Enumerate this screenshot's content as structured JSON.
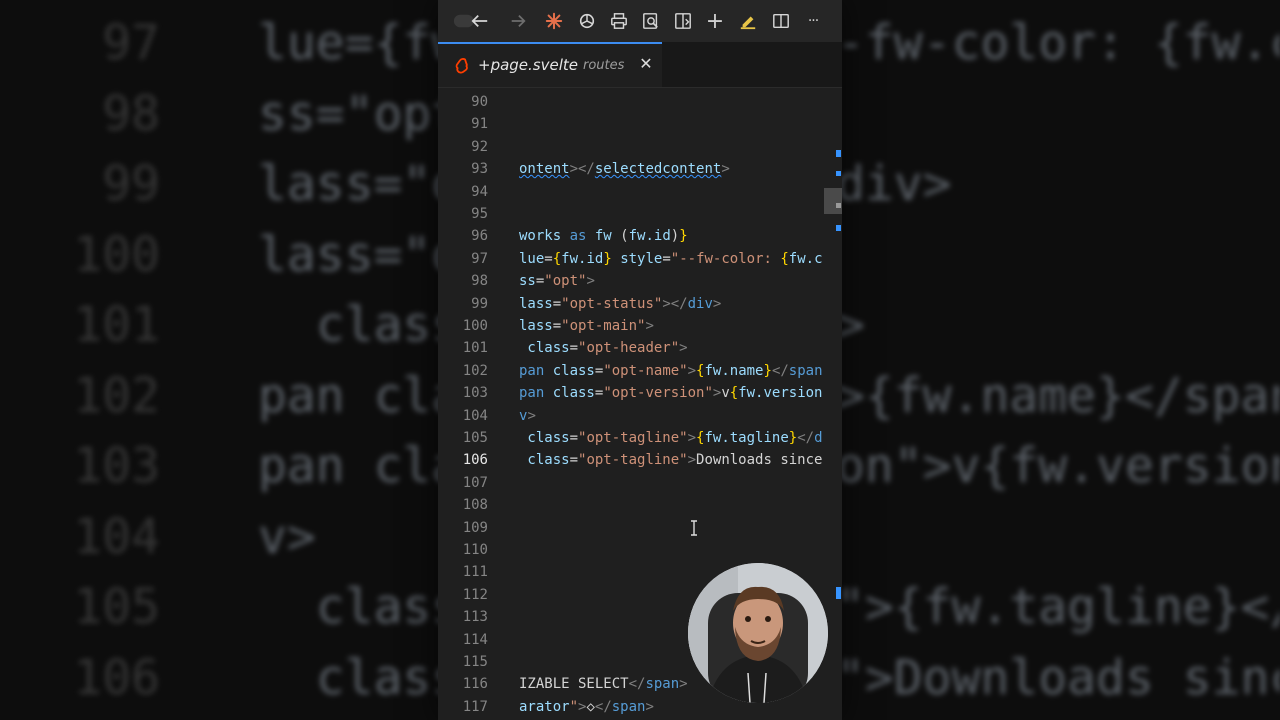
{
  "background": {
    "lines": [
      {
        "num": "97",
        "code": "lue={fw.id} style=\"--fw-color: {fw.c"
      },
      {
        "num": "98",
        "code": "ss=\"opt\">"
      },
      {
        "num": "99",
        "code": "lass=\"opt-status\"></div>"
      },
      {
        "num": "100",
        "code": "lass=\"opt-main\">"
      },
      {
        "num": "101",
        "code": "  class=\"opt-header\">"
      },
      {
        "num": "102",
        "code": "pan class=\"opt-name\">{fw.name}</span"
      },
      {
        "num": "103",
        "code": "pan class=\"opt-version\">v{fw.version"
      },
      {
        "num": "104",
        "code": "v>"
      },
      {
        "num": "105",
        "code": "  class=\"opt-tagline\">{fw.tagline}</d"
      },
      {
        "num": "106",
        "code": "  class=\"opt-tagline\">Downloads since"
      }
    ]
  },
  "toolbar": {
    "icons": [
      "back-arrow-icon",
      "forward-arrow-icon",
      "claude-icon",
      "openai-icon",
      "print-icon",
      "search-doc-icon",
      "split-compare-icon",
      "add-icon",
      "highlight-pen-icon",
      "split-editor-icon",
      "more-icon"
    ],
    "more_label": "···",
    "add_label": "+"
  },
  "tab": {
    "title": "+page.svelte",
    "description": "routes",
    "close_label": "✕",
    "icon": "svelte-icon"
  },
  "editor": {
    "active_line": "106",
    "lines": [
      {
        "num": "90",
        "tokens": []
      },
      {
        "num": "91",
        "tokens": []
      },
      {
        "num": "92",
        "tokens": []
      },
      {
        "num": "93",
        "tokens": [
          {
            "t": "ontent",
            "c": "t-attr squiggle"
          },
          {
            "t": "></",
            "c": "t-tag"
          },
          {
            "t": "selectedcontent",
            "c": "t-attr squiggle"
          },
          {
            "t": ">",
            "c": "t-tag"
          }
        ]
      },
      {
        "num": "94",
        "tokens": []
      },
      {
        "num": "95",
        "tokens": []
      },
      {
        "num": "96",
        "tokens": [
          {
            "t": "works ",
            "c": "t-var"
          },
          {
            "t": "as ",
            "c": "t-kw"
          },
          {
            "t": "fw ",
            "c": "t-var"
          },
          {
            "t": "(",
            "c": "t-plain"
          },
          {
            "t": "fw.id",
            "c": "t-var"
          },
          {
            "t": ")",
            "c": "t-plain"
          },
          {
            "t": "}",
            "c": "t-brace"
          }
        ]
      },
      {
        "num": "97",
        "tokens": [
          {
            "t": "lue",
            "c": "t-attr"
          },
          {
            "t": "=",
            "c": "t-plain"
          },
          {
            "t": "{",
            "c": "t-brace"
          },
          {
            "t": "fw.id",
            "c": "t-var"
          },
          {
            "t": "} ",
            "c": "t-brace"
          },
          {
            "t": "style",
            "c": "t-attr"
          },
          {
            "t": "=",
            "c": "t-plain"
          },
          {
            "t": "\"--fw-color: ",
            "c": "t-str"
          },
          {
            "t": "{",
            "c": "t-brace"
          },
          {
            "t": "fw.c",
            "c": "t-var"
          }
        ]
      },
      {
        "num": "98",
        "tokens": [
          {
            "t": "ss",
            "c": "t-attr"
          },
          {
            "t": "=",
            "c": "t-plain"
          },
          {
            "t": "\"opt\"",
            "c": "t-str"
          },
          {
            "t": ">",
            "c": "t-tag"
          }
        ]
      },
      {
        "num": "99",
        "tokens": [
          {
            "t": "lass",
            "c": "t-attr"
          },
          {
            "t": "=",
            "c": "t-plain"
          },
          {
            "t": "\"opt-status\"",
            "c": "t-str"
          },
          {
            "t": "></",
            "c": "t-tag"
          },
          {
            "t": "div",
            "c": "t-name"
          },
          {
            "t": ">",
            "c": "t-tag"
          }
        ]
      },
      {
        "num": "100",
        "tokens": [
          {
            "t": "lass",
            "c": "t-attr"
          },
          {
            "t": "=",
            "c": "t-plain"
          },
          {
            "t": "\"opt-main\"",
            "c": "t-str"
          },
          {
            "t": ">",
            "c": "t-tag"
          }
        ]
      },
      {
        "num": "101",
        "tokens": [
          {
            "t": " class",
            "c": "t-attr"
          },
          {
            "t": "=",
            "c": "t-plain"
          },
          {
            "t": "\"opt-header\"",
            "c": "t-str"
          },
          {
            "t": ">",
            "c": "t-tag"
          }
        ]
      },
      {
        "num": "102",
        "tokens": [
          {
            "t": "pan ",
            "c": "t-name"
          },
          {
            "t": "class",
            "c": "t-attr"
          },
          {
            "t": "=",
            "c": "t-plain"
          },
          {
            "t": "\"opt-name\"",
            "c": "t-str"
          },
          {
            "t": ">",
            "c": "t-tag"
          },
          {
            "t": "{",
            "c": "t-brace"
          },
          {
            "t": "fw.name",
            "c": "t-var"
          },
          {
            "t": "}",
            "c": "t-brace"
          },
          {
            "t": "</",
            "c": "t-tag"
          },
          {
            "t": "span",
            "c": "t-name"
          }
        ]
      },
      {
        "num": "103",
        "tokens": [
          {
            "t": "pan ",
            "c": "t-name"
          },
          {
            "t": "class",
            "c": "t-attr"
          },
          {
            "t": "=",
            "c": "t-plain"
          },
          {
            "t": "\"opt-version\"",
            "c": "t-str"
          },
          {
            "t": ">",
            "c": "t-tag"
          },
          {
            "t": "v",
            "c": "t-plain"
          },
          {
            "t": "{",
            "c": "t-brace"
          },
          {
            "t": "fw.version",
            "c": "t-var"
          }
        ]
      },
      {
        "num": "104",
        "tokens": [
          {
            "t": "v",
            "c": "t-name"
          },
          {
            "t": ">",
            "c": "t-tag"
          }
        ]
      },
      {
        "num": "105",
        "tokens": [
          {
            "t": " class",
            "c": "t-attr"
          },
          {
            "t": "=",
            "c": "t-plain"
          },
          {
            "t": "\"opt-tagline\"",
            "c": "t-str"
          },
          {
            "t": ">",
            "c": "t-tag"
          },
          {
            "t": "{",
            "c": "t-brace"
          },
          {
            "t": "fw.tagline",
            "c": "t-var"
          },
          {
            "t": "}",
            "c": "t-brace"
          },
          {
            "t": "</",
            "c": "t-tag"
          },
          {
            "t": "d",
            "c": "t-name"
          }
        ]
      },
      {
        "num": "106",
        "tokens": [
          {
            "t": " class",
            "c": "t-attr"
          },
          {
            "t": "=",
            "c": "t-plain"
          },
          {
            "t": "\"opt-tagline\"",
            "c": "t-str"
          },
          {
            "t": ">",
            "c": "t-tag"
          },
          {
            "t": "Downloads since",
            "c": "t-plain"
          }
        ]
      },
      {
        "num": "107",
        "tokens": []
      },
      {
        "num": "108",
        "tokens": []
      },
      {
        "num": "109",
        "tokens": []
      },
      {
        "num": "110",
        "tokens": []
      },
      {
        "num": "111",
        "tokens": []
      },
      {
        "num": "112",
        "tokens": []
      },
      {
        "num": "113",
        "tokens": []
      },
      {
        "num": "114",
        "tokens": []
      },
      {
        "num": "115",
        "tokens": []
      },
      {
        "num": "116",
        "tokens": [
          {
            "t": "IZABLE SELECT",
            "c": "t-plain"
          },
          {
            "t": "</",
            "c": "t-tag"
          },
          {
            "t": "span",
            "c": "t-name"
          },
          {
            "t": ">",
            "c": "t-tag"
          }
        ]
      },
      {
        "num": "117",
        "tokens": [
          {
            "t": "arator",
            "c": "t-attr"
          },
          {
            "t": "\"",
            "c": "t-str"
          },
          {
            "t": ">",
            "c": "t-tag"
          },
          {
            "t": "◇",
            "c": "t-plain"
          },
          {
            "t": "</",
            "c": "t-tag"
          },
          {
            "t": "span",
            "c": "t-name"
          },
          {
            "t": ">",
            "c": "t-tag"
          }
        ]
      }
    ]
  },
  "colors": {
    "accent": "#3794ff",
    "svelte": "#ff3e00",
    "claude": "#e5704b"
  }
}
